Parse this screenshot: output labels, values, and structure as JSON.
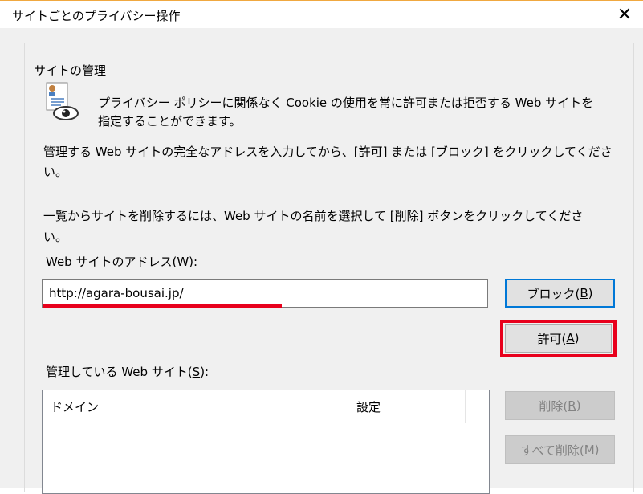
{
  "window": {
    "title": "サイトごとのプライバシー操作",
    "close_glyph": "✕"
  },
  "group": {
    "legend": "サイトの管理"
  },
  "info": {
    "icon": "privacy-eye-icon",
    "line1": "プライバシー ポリシーに関係なく Cookie の使用を常に許可または拒否する Web サイトを",
    "line2": "指定することができます。"
  },
  "instructions": {
    "p1_line1": "管理する Web サイトの完全なアドレスを入力してから、[許可] または [ブロック] をクリックしてくださ",
    "p1_line2": "い。",
    "p2_line1": "一覧からサイトを削除するには、Web サイトの名前を選択して [削除] ボタンをクリックしてくださ",
    "p2_line2": "い。"
  },
  "address": {
    "label_prefix": "Web サイトのアドレス(",
    "label_key": "W",
    "label_suffix": "):",
    "value": "http://agara-bousai.jp/"
  },
  "buttons": {
    "block": {
      "prefix": "ブロック(",
      "key": "B",
      "suffix": ")"
    },
    "allow": {
      "prefix": "許可(",
      "key": "A",
      "suffix": ")"
    },
    "remove": {
      "prefix": "削除(",
      "key": "R",
      "suffix": ")"
    },
    "remove_all": {
      "prefix": "すべて削除(",
      "key": "M",
      "suffix": ")"
    }
  },
  "managed": {
    "label_prefix": "管理している Web サイト(",
    "label_key": "S",
    "label_suffix": "):",
    "columns": [
      "ドメイン",
      "設定"
    ],
    "rows": []
  },
  "colors": {
    "annotation_red": "#e8001c",
    "focus_blue": "#0078d7",
    "dialog_bg": "#f0f0f0"
  }
}
